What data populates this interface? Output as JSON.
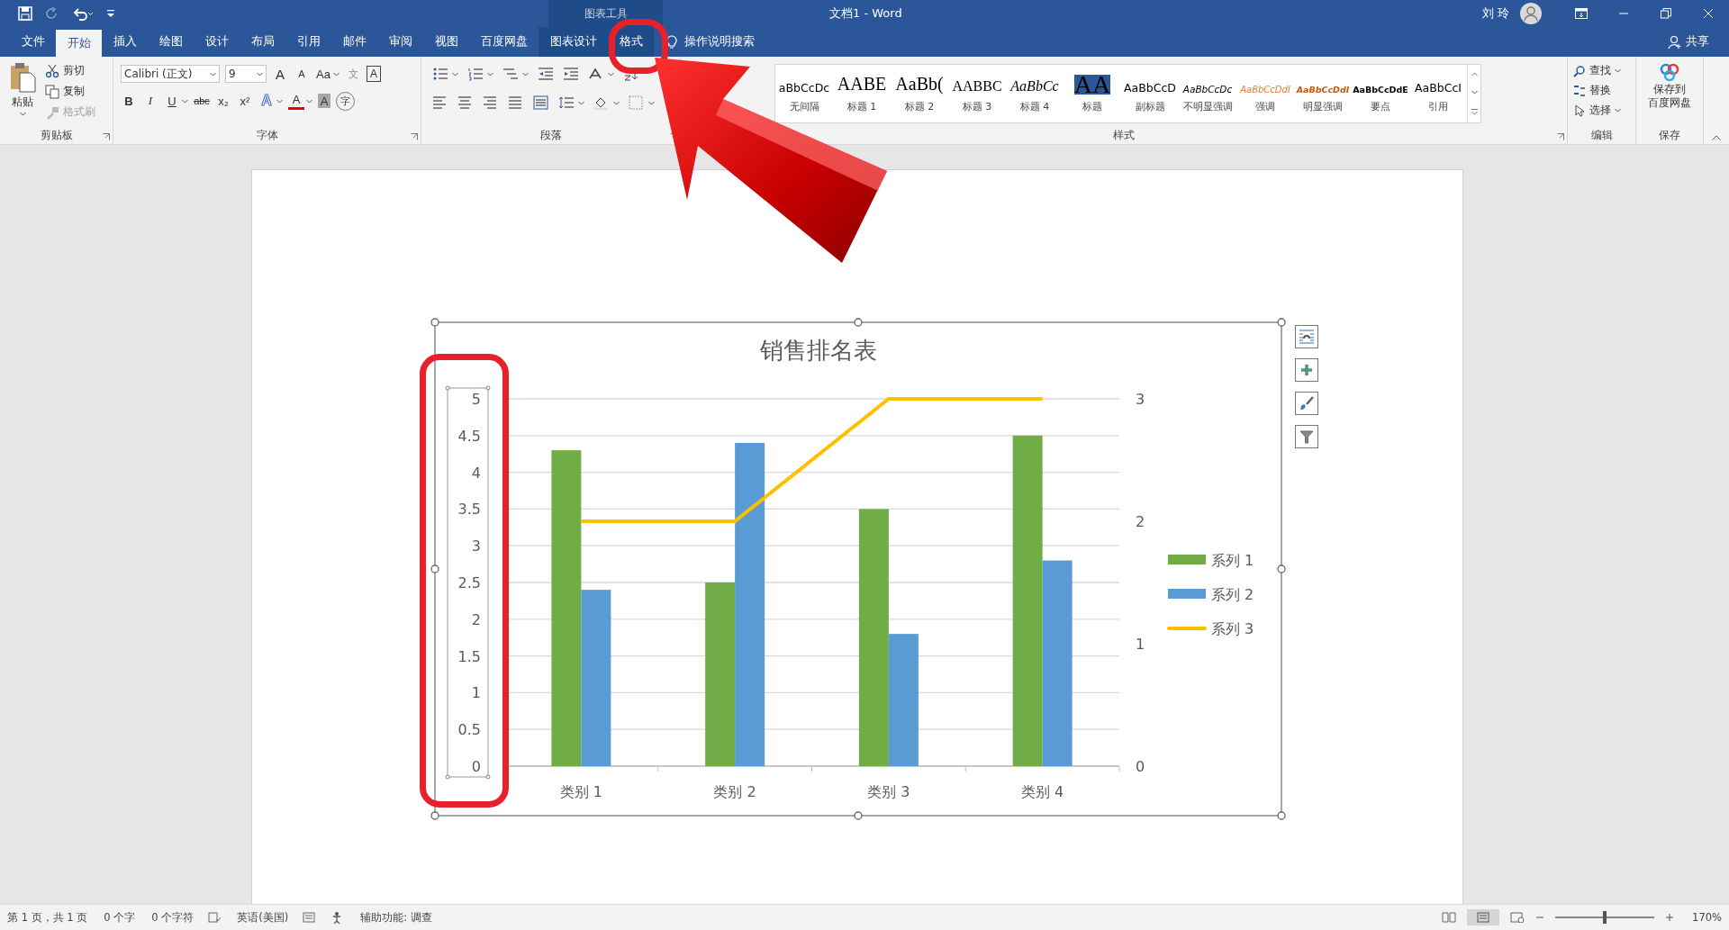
{
  "window": {
    "context_group": "图表工具",
    "title": "文档1 - Word",
    "user": "刘 玲"
  },
  "menu_tabs": [
    {
      "label": "文件",
      "selected": false,
      "contextual": false
    },
    {
      "label": "开始",
      "selected": true,
      "contextual": false
    },
    {
      "label": "插入",
      "selected": false,
      "contextual": false
    },
    {
      "label": "绘图",
      "selected": false,
      "contextual": false
    },
    {
      "label": "设计",
      "selected": false,
      "contextual": false
    },
    {
      "label": "布局",
      "selected": false,
      "contextual": false
    },
    {
      "label": "引用",
      "selected": false,
      "contextual": false
    },
    {
      "label": "邮件",
      "selected": false,
      "contextual": false
    },
    {
      "label": "审阅",
      "selected": false,
      "contextual": false
    },
    {
      "label": "视图",
      "selected": false,
      "contextual": false
    },
    {
      "label": "百度网盘",
      "selected": false,
      "contextual": false
    },
    {
      "label": "图表设计",
      "selected": false,
      "contextual": true
    },
    {
      "label": "格式",
      "selected": false,
      "contextual": true
    }
  ],
  "tell_me": "操作说明搜索",
  "share": "共享",
  "ribbon": {
    "clipboard": {
      "group": "剪贴板",
      "paste": "粘贴",
      "items": [
        {
          "label": "剪切",
          "disabled": false
        },
        {
          "label": "复制",
          "disabled": false
        },
        {
          "label": "格式刷",
          "disabled": true
        }
      ]
    },
    "font": {
      "group": "字体",
      "font_name": "Calibri (正文)",
      "font_size": "9",
      "row1": [
        {
          "text": "A",
          "kind": "grow"
        },
        {
          "text": "A",
          "kind": "shrink"
        },
        {
          "text": "Aa",
          "kind": "case"
        },
        {
          "text": "文",
          "kind": "phonetic"
        },
        {
          "text": "A",
          "kind": "border"
        }
      ],
      "row2": [
        {
          "text": "B",
          "kind": "bold"
        },
        {
          "text": "I",
          "kind": "italic"
        },
        {
          "text": "U",
          "kind": "underline"
        },
        {
          "text": "abc",
          "kind": "strike"
        },
        {
          "text": "x₂",
          "kind": "plain"
        },
        {
          "text": "x²",
          "kind": "plain"
        },
        {
          "text": "A",
          "kind": "effect"
        },
        {
          "text": "A",
          "kind": "color"
        },
        {
          "text": "A",
          "kind": "shade"
        },
        {
          "text": "字",
          "kind": "enclosed"
        }
      ]
    },
    "paragraph": {
      "group": "段落"
    },
    "styles": {
      "group": "样式",
      "items": [
        {
          "sample": "aBbCcDc",
          "label": "无间隔",
          "kind": "plain"
        },
        {
          "sample": "AABE",
          "label": "标题 1",
          "kind": "seriflarge"
        },
        {
          "sample": "AaBb(",
          "label": "标题 2",
          "kind": "seriflarge"
        },
        {
          "sample": "AABBC",
          "label": "标题 3",
          "kind": "serif"
        },
        {
          "sample": "AaBbCc",
          "label": "标题 4",
          "kind": "serifitalic"
        },
        {
          "sample": "AA",
          "label": "标题",
          "kind": "title"
        },
        {
          "sample": "AaBbCcD",
          "label": "副标题",
          "kind": "plain"
        },
        {
          "sample": "AaBbCcDc",
          "label": "不明显强调",
          "kind": "italic"
        },
        {
          "sample": "AaBbCcDdI",
          "label": "强调",
          "kind": "emphasis"
        },
        {
          "sample": "AaBbCcDdI",
          "label": "明显强调",
          "kind": "intense"
        },
        {
          "sample": "AaBbCcDdE",
          "label": "要点",
          "kind": "strong"
        },
        {
          "sample": "AaBbCcI",
          "label": "引用",
          "kind": "plain"
        }
      ]
    },
    "editing": {
      "group": "编辑",
      "items": [
        "查找",
        "替换",
        "选择"
      ]
    },
    "save": {
      "group": "保存",
      "label_lines": [
        "保存到",
        "百度网盘"
      ]
    }
  },
  "chart": {
    "chart_data": {
      "type": "bar",
      "title": "销售排名表",
      "categories": [
        "类别 1",
        "类别 2",
        "类别 3",
        "类别 4"
      ],
      "series": [
        {
          "name": "系列 1",
          "color": "#70ad47",
          "values": [
            4.3,
            2.5,
            3.5,
            4.5
          ]
        },
        {
          "name": "系列 2",
          "color": "#5b9bd5",
          "values": [
            2.4,
            4.4,
            1.8,
            2.8
          ]
        },
        {
          "name": "系列 3",
          "color": "#ffc000",
          "type": "line",
          "axis": "y2",
          "values": [
            2,
            2,
            3,
            3
          ]
        }
      ],
      "ylim": [
        0,
        5
      ],
      "yticks": [
        0,
        0.5,
        1,
        1.5,
        2,
        2.5,
        3,
        3.5,
        4,
        4.5,
        5
      ],
      "y2lim": [
        0,
        3
      ],
      "y2ticks": [
        0,
        1,
        2,
        3
      ],
      "grid": true,
      "legend": "right"
    }
  },
  "status_bar": {
    "items": [
      "第 1 页，共 1 页",
      "0 个字",
      "0 个字符",
      "英语(美国)",
      "辅助功能: 调查"
    ],
    "zoom": "170%",
    "zoom_slider": {
      "level": 0.5
    }
  }
}
